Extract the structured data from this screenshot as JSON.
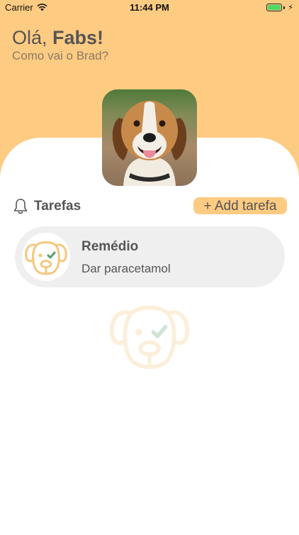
{
  "status_bar": {
    "carrier": "Carrier",
    "time": "11:44 PM"
  },
  "header": {
    "greeting_prefix": "Olá, ",
    "user_name": "Fabs!",
    "subtitle": "Como vai o Brad?"
  },
  "tasks_section": {
    "title": "Tarefas",
    "add_button_label": "+ Add tarefa",
    "items": [
      {
        "title": "Remédio",
        "description": "Dar paracetamol"
      }
    ]
  },
  "colors": {
    "accent": "#FECB82",
    "card_background": "#EFEFEF",
    "text": "#555555",
    "check": "#5E9E6B"
  },
  "icons": [
    "wifi-icon",
    "battery-icon",
    "bell-icon",
    "dog-face-icon",
    "checkmark-icon"
  ]
}
